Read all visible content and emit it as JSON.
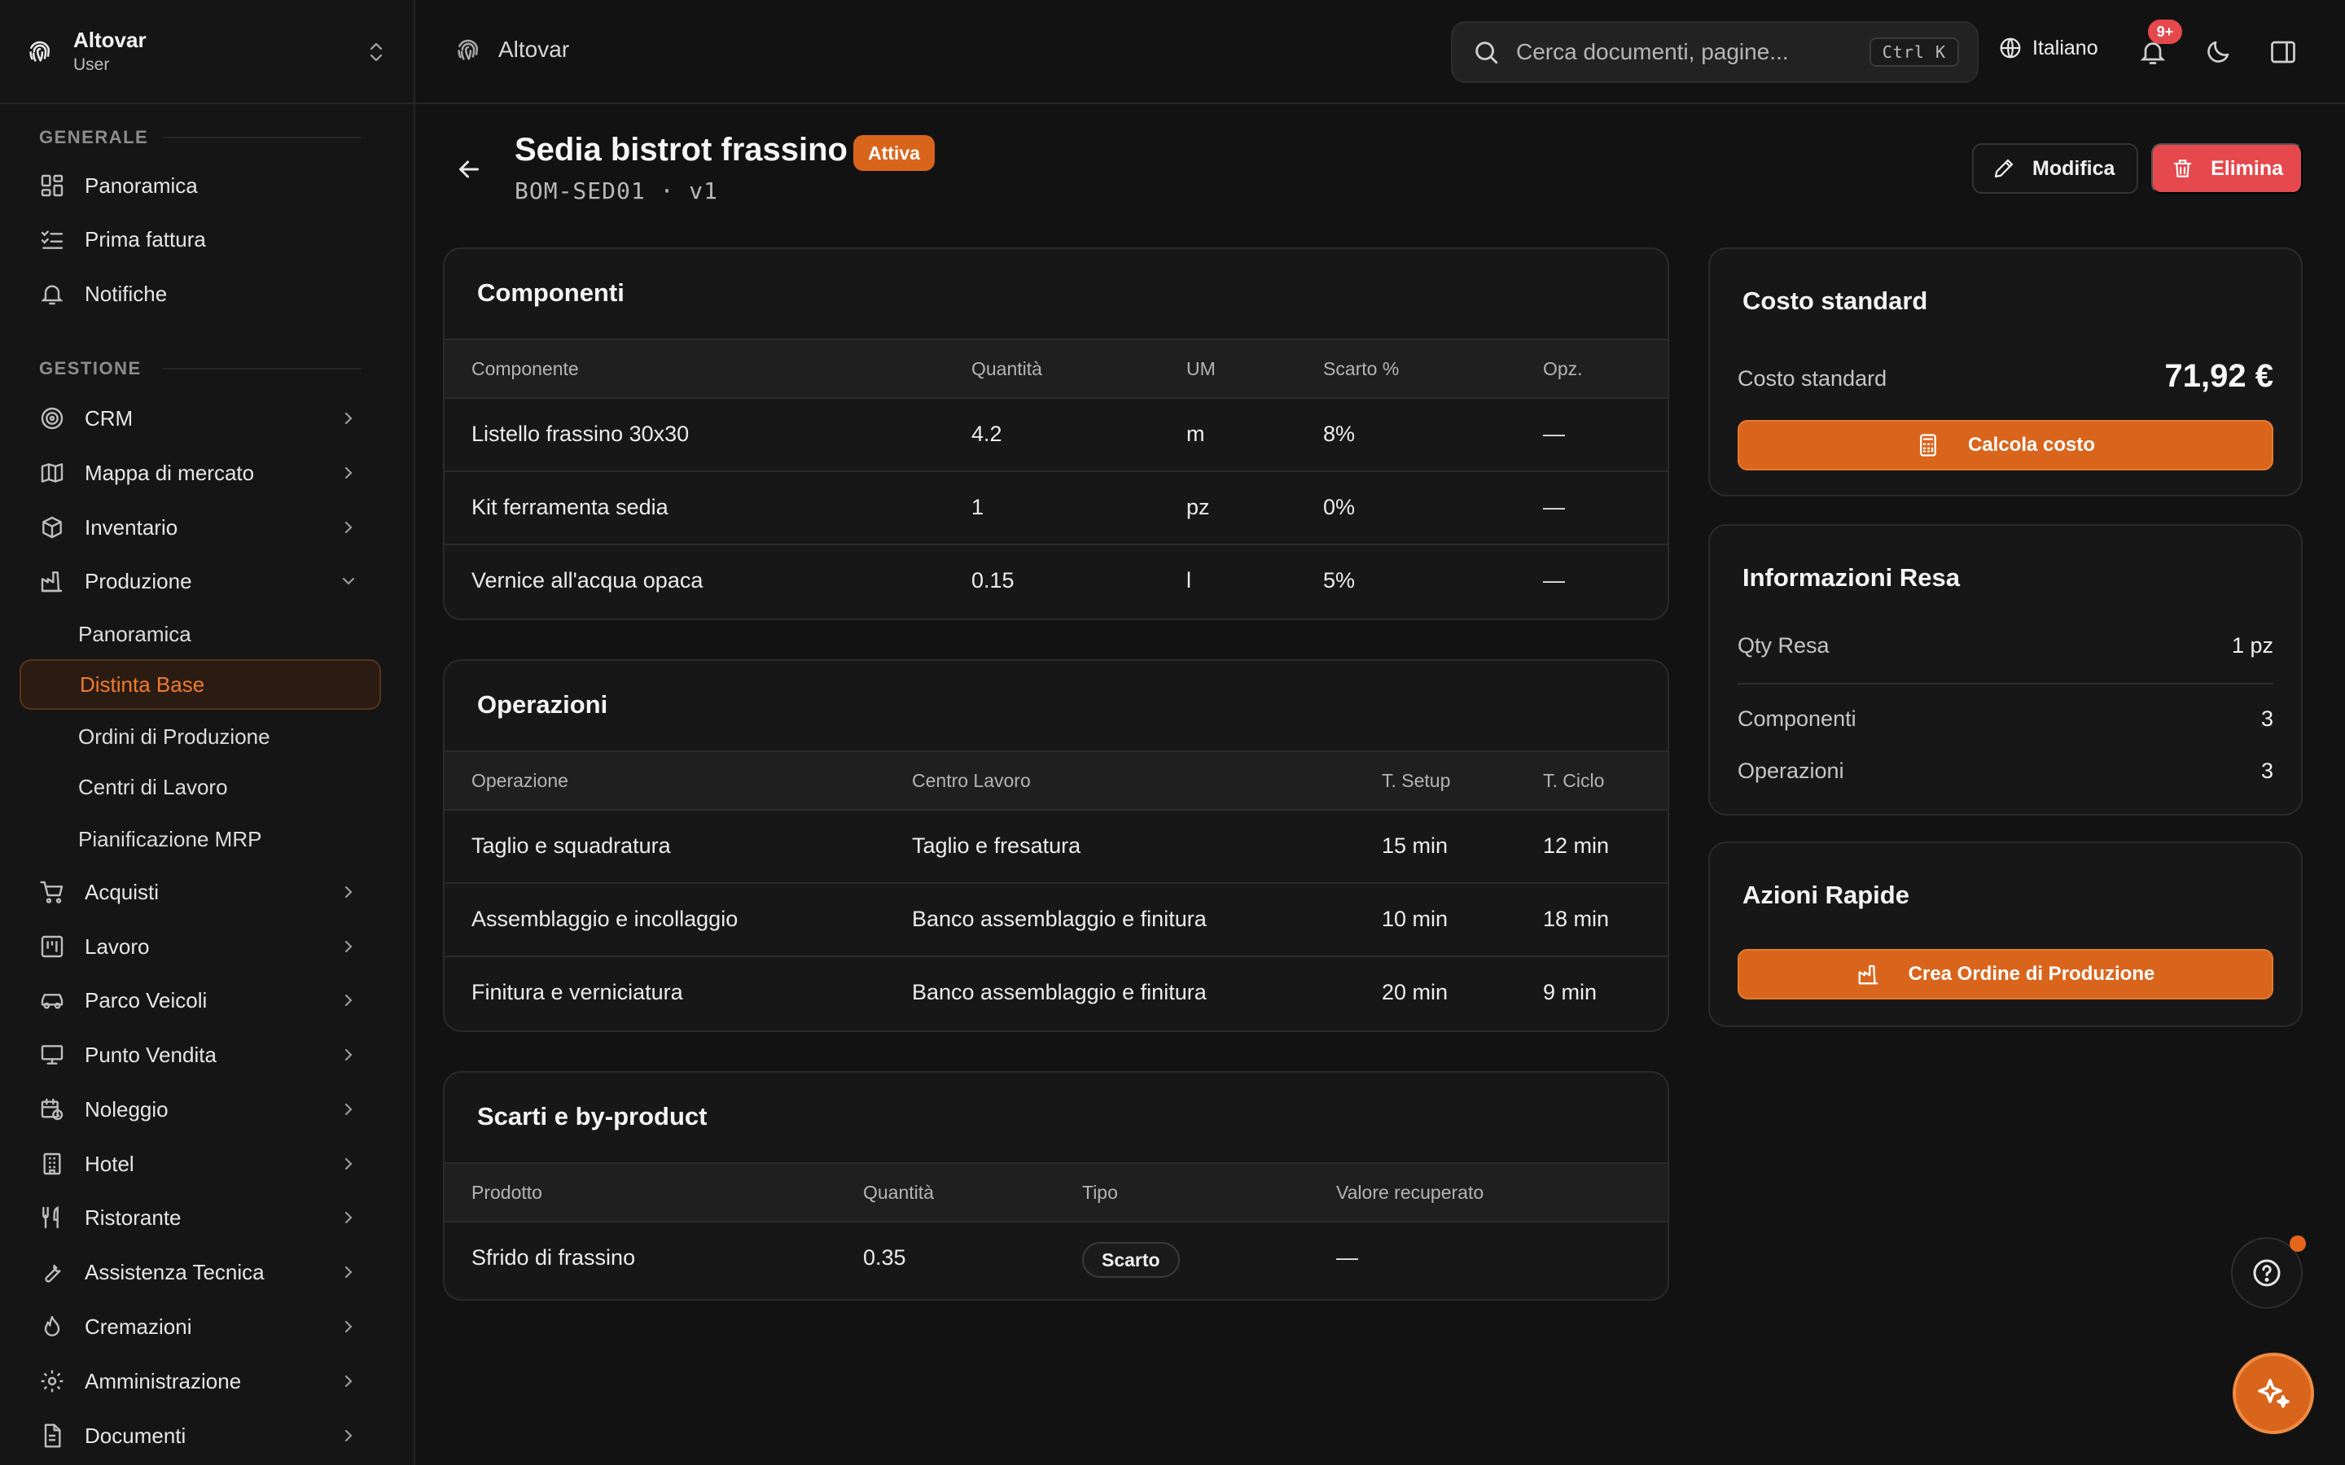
{
  "brand": {
    "name": "Altovar",
    "role": "User"
  },
  "sidebar": {
    "sections": [
      {
        "title": "GENERALE"
      },
      {
        "title": "GESTIONE"
      }
    ],
    "general": [
      {
        "label": "Panoramica",
        "icon": "dashboard-icon"
      },
      {
        "label": "Prima fattura",
        "icon": "checklist-icon"
      },
      {
        "label": "Notifiche",
        "icon": "bell-icon"
      }
    ],
    "management": [
      {
        "label": "CRM",
        "icon": "target-icon"
      },
      {
        "label": "Mappa di mercato",
        "icon": "map-icon"
      },
      {
        "label": "Inventario",
        "icon": "box-icon"
      },
      {
        "label": "Produzione",
        "icon": "factory-icon",
        "expanded": true
      }
    ],
    "production_sub": [
      {
        "label": "Panoramica"
      },
      {
        "label": "Distinta Base",
        "active": true
      },
      {
        "label": "Ordini di Produzione"
      },
      {
        "label": "Centri di Lavoro"
      },
      {
        "label": "Pianificazione MRP"
      }
    ],
    "more": [
      {
        "label": "Acquisti",
        "icon": "cart-icon"
      },
      {
        "label": "Lavoro",
        "icon": "kanban-icon"
      },
      {
        "label": "Parco Veicoli",
        "icon": "car-icon"
      },
      {
        "label": "Punto Vendita",
        "icon": "monitor-icon"
      },
      {
        "label": "Noleggio",
        "icon": "calendar-clock-icon"
      },
      {
        "label": "Hotel",
        "icon": "building-icon"
      },
      {
        "label": "Ristorante",
        "icon": "utensils-icon"
      },
      {
        "label": "Assistenza Tecnica",
        "icon": "wrench-icon"
      },
      {
        "label": "Cremazioni",
        "icon": "flame-icon"
      },
      {
        "label": "Amministrazione",
        "icon": "gear-icon"
      },
      {
        "label": "Documenti",
        "icon": "document-icon"
      }
    ]
  },
  "topbar": {
    "breadcrumb": "Altovar",
    "search_placeholder": "Cerca documenti, pagine...",
    "shortcut": "Ctrl K",
    "language": "Italiano",
    "notifications_badge": "9+"
  },
  "page": {
    "title": "Sedia bistrot frassino",
    "status": "Attiva",
    "subtitle": "BOM-SED01 · v1",
    "edit_label": "Modifica",
    "delete_label": "Elimina"
  },
  "components": {
    "title": "Componenti",
    "headers": [
      "Componente",
      "Quantità",
      "UM",
      "Scarto %",
      "Opz."
    ],
    "rows": [
      [
        "Listello frassino 30x30",
        "4.2",
        "m",
        "8%",
        "—"
      ],
      [
        "Kit ferramenta sedia",
        "1",
        "pz",
        "0%",
        "—"
      ],
      [
        "Vernice all'acqua opaca",
        "0.15",
        "l",
        "5%",
        "—"
      ]
    ]
  },
  "operations": {
    "title": "Operazioni",
    "headers": [
      "Operazione",
      "Centro Lavoro",
      "T. Setup",
      "T. Ciclo"
    ],
    "rows": [
      [
        "Taglio e squadratura",
        "Taglio e fresatura",
        "15 min",
        "12 min"
      ],
      [
        "Assemblaggio e incollaggio",
        "Banco assemblaggio e finitura",
        "10 min",
        "18 min"
      ],
      [
        "Finitura e verniciatura",
        "Banco assemblaggio e finitura",
        "20 min",
        "9 min"
      ]
    ]
  },
  "byproducts": {
    "title": "Scarti e by-product",
    "headers": [
      "Prodotto",
      "Quantità",
      "Tipo",
      "Valore recuperato"
    ],
    "rows": [
      [
        "Sfrido di frassino",
        "0.35",
        "Scarto",
        "—"
      ]
    ]
  },
  "standard_cost": {
    "title": "Costo standard",
    "label": "Costo standard",
    "value": "71,92 €",
    "button": "Calcola costo"
  },
  "yield_info": {
    "title": "Informazioni Resa",
    "rows": [
      {
        "label": "Qty Resa",
        "value": "1 pz"
      },
      {
        "label": "Componenti",
        "value": "3"
      },
      {
        "label": "Operazioni",
        "value": "3"
      }
    ]
  },
  "quick_actions": {
    "title": "Azioni Rapide",
    "button": "Crea Ordine di Produzione"
  },
  "colors": {
    "accent": "#d9651c",
    "danger": "#e5484d",
    "background": "#121212",
    "card": "#171717"
  }
}
